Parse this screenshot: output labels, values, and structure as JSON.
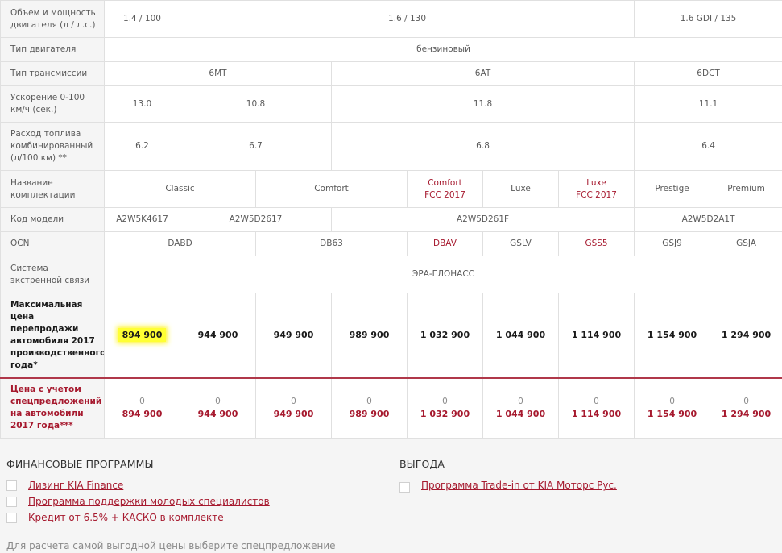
{
  "spec_table": {
    "engine_label": "Объем и мощность двигателя (л / л.с.)",
    "engine_1": "1.4 / 100",
    "engine_2": "1.6 / 130",
    "engine_3": "1.6 GDI / 135",
    "engine_type_label": "Тип двигателя",
    "engine_type": "бензиновый",
    "transmission_label": "Тип трансмиссии",
    "trans_1": "6MT",
    "trans_2": "6AT",
    "trans_3": "6DCT",
    "accel_label": "Ускорение 0-100 км/ч (сек.)",
    "accel_1": "13.0",
    "accel_2": "10.8",
    "accel_3": "11.8",
    "accel_4": "11.1",
    "fuel_label": "Расход топлива комбинированный (л/100 км) **",
    "fuel_1": "6.2",
    "fuel_2": "6.7",
    "fuel_3": "6.8",
    "fuel_4": "6.4",
    "trim_label": "Название комплектации",
    "trim_classic": "Classic",
    "trim_comfort": "Comfort",
    "trim_comfort_fcc_1": "Comfort",
    "trim_comfort_fcc_2": "FCC 2017",
    "trim_luxe": "Luxe",
    "trim_luxe_fcc_1": "Luxe",
    "trim_luxe_fcc_2": "FCC 2017",
    "trim_prestige": "Prestige",
    "trim_premium": "Premium",
    "model_code_label": "Код модели",
    "model_1": "A2W5K4617",
    "model_2": "A2W5D2617",
    "model_3": "A2W5D261F",
    "model_4": "A2W5D2A1T",
    "ocn_label": "OCN",
    "ocn_1": "DABD",
    "ocn_2": "DB63",
    "ocn_3": "DBAV",
    "ocn_4": "GSLV",
    "ocn_5": "GSS5",
    "ocn_6": "GSJ9",
    "ocn_7": "GSJA",
    "emergency_label": "Система экстренной связи",
    "emergency": "ЭРА-ГЛОНАСС",
    "max_price_label": "Максимальная цена перепродажи автомобиля 2017 производственного года*",
    "max_prices": [
      "894 900",
      "944 900",
      "949 900",
      "989 900",
      "1 032 900",
      "1 044 900",
      "1 114 900",
      "1 154 900",
      "1 294 900"
    ],
    "special_label": "Цена с учетом спецпредложений на автомобили 2017 года***",
    "special_zero": "0",
    "special_prices": [
      "894 900",
      "944 900",
      "949 900",
      "989 900",
      "1 032 900",
      "1 044 900",
      "1 114 900",
      "1 154 900",
      "1 294 900"
    ]
  },
  "finance": {
    "title": "ФИНАНСОВЫЕ ПРОГРАММЫ",
    "items": [
      "Лизинг KIA Finance",
      "Программа поддержки молодых специалистов",
      "Кредит от 6.5% + КАСКО в комплекте"
    ]
  },
  "benefit": {
    "title": "ВЫГОДА",
    "items": [
      "Программа Trade-in от KIA Моторс Рус."
    ]
  },
  "footer_note": "Для расчета самой выгодной цены выберите спецпредложение"
}
